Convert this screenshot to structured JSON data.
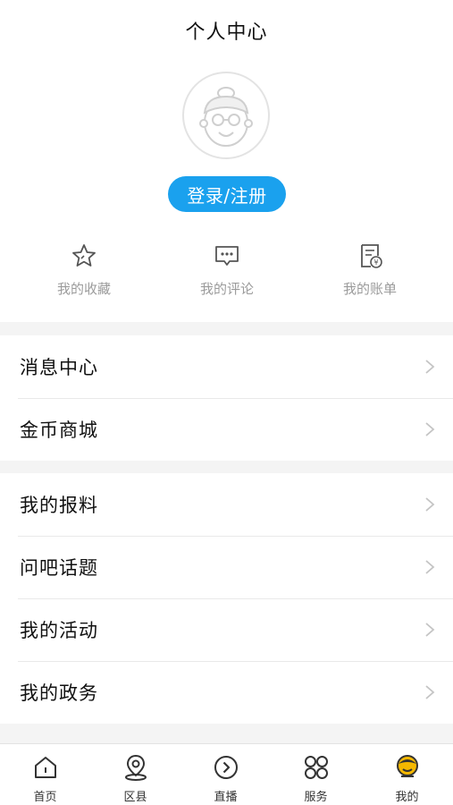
{
  "header": {
    "title": "个人中心",
    "login_label": "登录/注册"
  },
  "quick_actions": [
    {
      "label": "我的收藏",
      "icon": "star-icon"
    },
    {
      "label": "我的评论",
      "icon": "comment-icon"
    },
    {
      "label": "我的账单",
      "icon": "bill-icon"
    }
  ],
  "menu_groups": [
    {
      "items": [
        {
          "label": "消息中心"
        },
        {
          "label": "金币商城"
        }
      ]
    },
    {
      "items": [
        {
          "label": "我的报料"
        },
        {
          "label": "问吧话题"
        },
        {
          "label": "我的活动"
        },
        {
          "label": "我的政务"
        }
      ]
    }
  ],
  "tabbar": {
    "items": [
      {
        "label": "首页",
        "icon": "home-icon"
      },
      {
        "label": "区县",
        "icon": "location-pin-icon"
      },
      {
        "label": "直播",
        "icon": "play-circle-icon"
      },
      {
        "label": "服务",
        "icon": "grid-icon"
      },
      {
        "label": "我的",
        "icon": "user-face-icon",
        "active": true
      }
    ]
  },
  "colors": {
    "accent": "#1aa1ee",
    "active_tab": "#f5b800",
    "muted_text": "#9b9b9b"
  }
}
